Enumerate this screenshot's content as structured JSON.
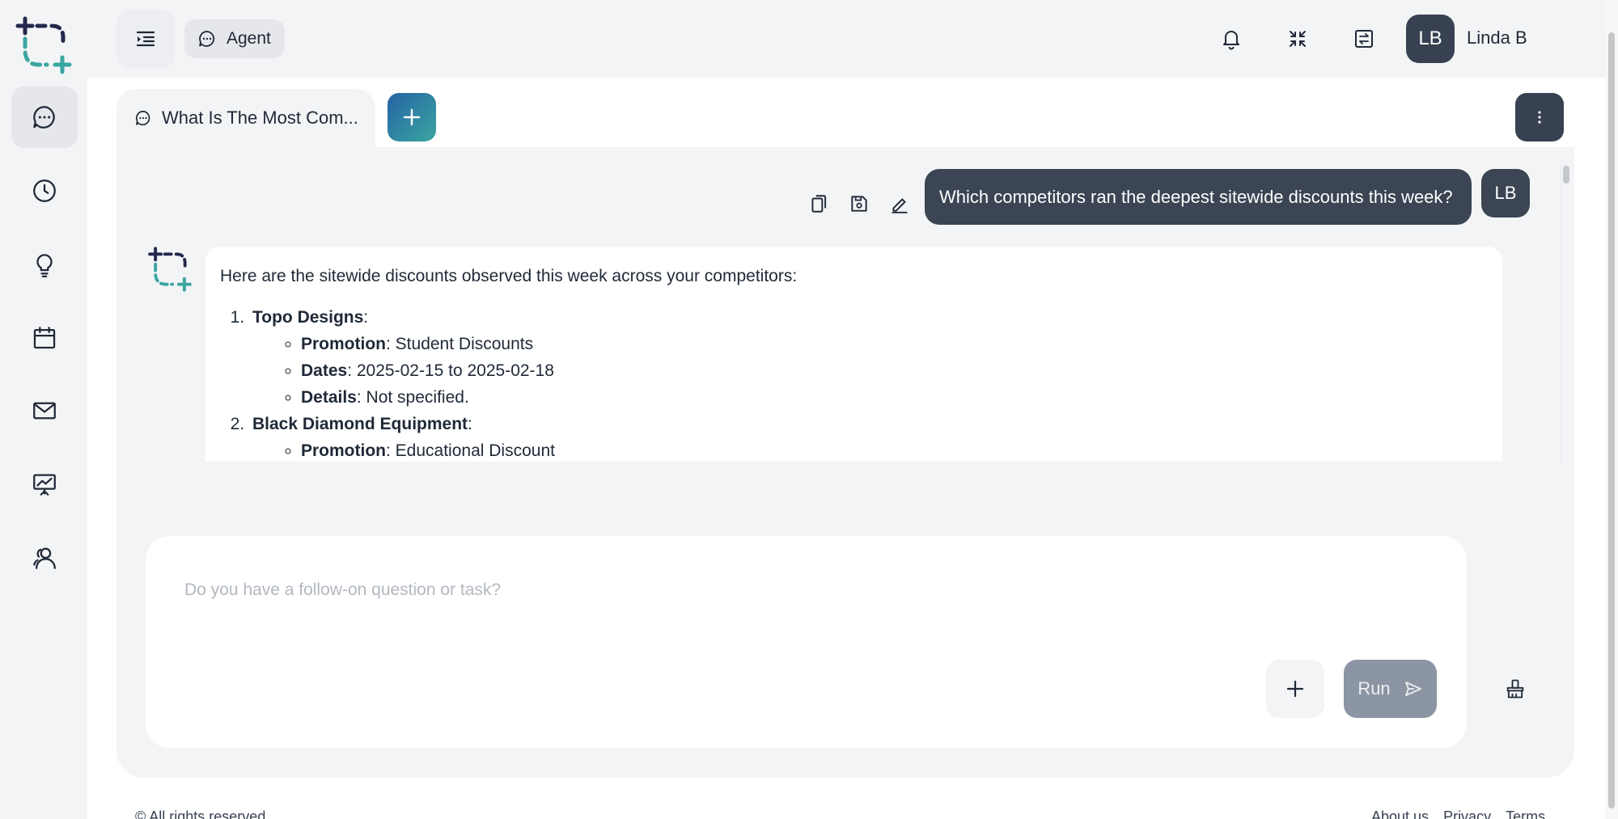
{
  "header": {
    "agent_label": "Agent",
    "user_initials": "LB",
    "user_name": "Linda B"
  },
  "icons": {
    "logo": "logo-crop-plus-icon",
    "menu": "menu-collapse-icon",
    "agent": "chat-bubble-icon",
    "notifications": "bell-icon",
    "fullscreen": "collapse-arrows-icon",
    "switch": "switch-arrows-icon"
  },
  "sidebar": {
    "items": [
      {
        "name": "chat",
        "icon": "chat-bubble-icon",
        "active": true
      },
      {
        "name": "history",
        "icon": "clock-icon",
        "active": false
      },
      {
        "name": "ideas",
        "icon": "lightbulb-icon",
        "active": false
      },
      {
        "name": "calendar",
        "icon": "calendar-icon",
        "active": false
      },
      {
        "name": "mail",
        "icon": "mail-icon",
        "active": false
      },
      {
        "name": "presentation",
        "icon": "chart-board-icon",
        "active": false
      },
      {
        "name": "users",
        "icon": "users-icon",
        "active": false
      }
    ]
  },
  "tabs": {
    "active_title": "What Is The Most Com..."
  },
  "conversation": {
    "user_message": "Which competitors ran the deepest sitewide discounts this week?",
    "user_initials": "LB",
    "answer_intro": "Here are the sitewide discounts observed this week across your competitors:",
    "competitors": [
      {
        "name": "Topo Designs",
        "fields": [
          {
            "label": "Promotion",
            "value": "Student Discounts"
          },
          {
            "label": "Dates",
            "value": "2025-02-15 to 2025-02-18"
          },
          {
            "label": "Details",
            "value": "Not specified."
          }
        ]
      },
      {
        "name": "Black Diamond Equipment",
        "fields": [
          {
            "label": "Promotion",
            "value": "Educational Discount"
          }
        ]
      }
    ]
  },
  "composer": {
    "placeholder": "Do you have a follow-on question or task?",
    "run_label": "Run"
  },
  "footer": {
    "copyright": "© All rights reserved",
    "links": [
      "About us",
      "Privacy",
      "Terms"
    ]
  },
  "colors": {
    "accent_dark": "#374151",
    "bubble": "#3b4554",
    "run_disabled": "#8c95a3",
    "logo_navy": "#24284d",
    "logo_teal": "#3aa6a0"
  }
}
